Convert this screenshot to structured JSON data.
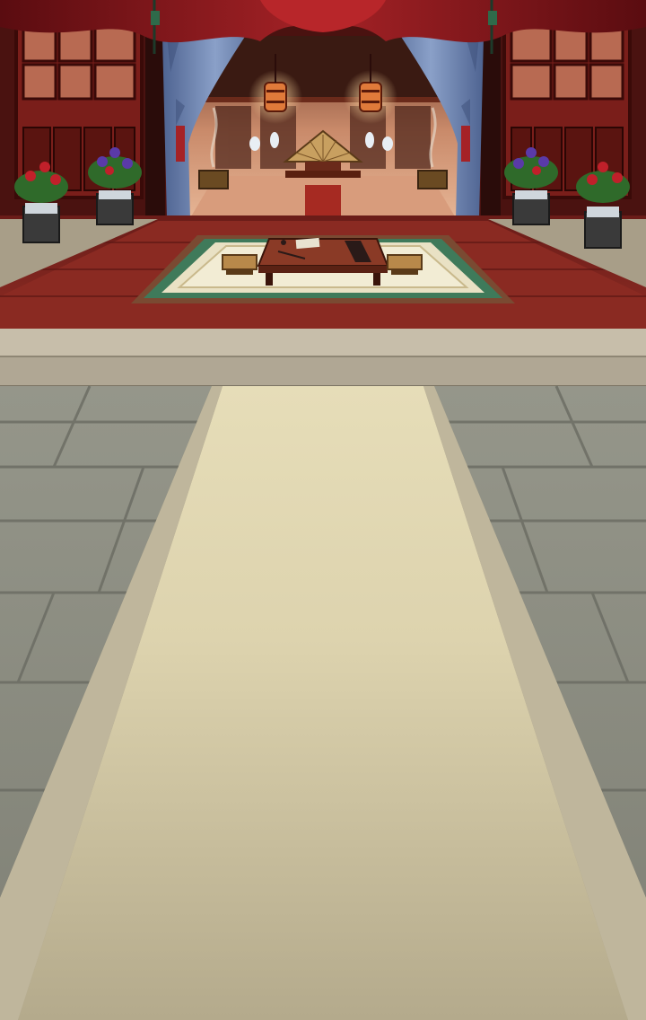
{
  "scene": {
    "name": "palace-hall-background",
    "palette": {
      "curtain_red": "#8e1a1c",
      "curtain_dark": "#5a0c10",
      "drape_blue": "#6f86b2",
      "wood_floor": "#8a2a22",
      "wood_floor_dark": "#5e1815",
      "stone_ledge": "#b8b09c",
      "stone_tiles": "#8e8f83",
      "carpet_path": "#d8cfb0",
      "carpet_edge": "#a39b82",
      "interior_glow": "#e8b08c",
      "flower_red": "#c0202a",
      "flower_purple": "#5a3aa8",
      "leaf_green": "#2f6a2a"
    },
    "icons": [
      "lantern-icon",
      "folding-fan-icon",
      "guqin-icon",
      "tea-table-icon",
      "flower-pot-icon",
      "incense-burner-icon"
    ]
  }
}
